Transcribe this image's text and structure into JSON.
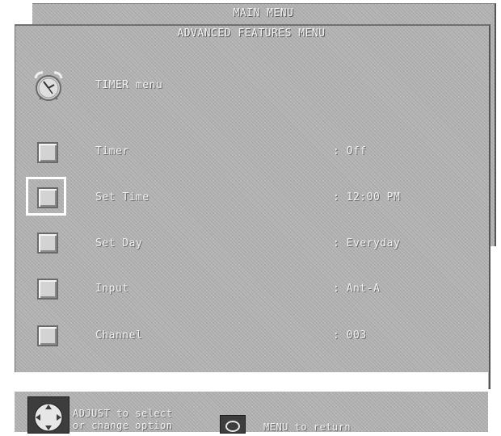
{
  "main_menu_title": "MAIN MENU",
  "advanced_title": "ADVANCED FEATURES MENU",
  "timer_header": "TIMER menu",
  "rows": [
    {
      "label": "Timer",
      "value": ":  Off"
    },
    {
      "label": "Set Time",
      "value": ": 12:00 PM"
    },
    {
      "label": "Set Day",
      "value": ": Everyday"
    },
    {
      "label": "Input",
      "value": ": Ant-A"
    },
    {
      "label": "Channel",
      "value": ": 003"
    }
  ],
  "selected_row": "Set Time",
  "footer": {
    "adjust_line1": "ADJUST to select",
    "adjust_line2": "or change option",
    "menu_hint": "MENU to return"
  },
  "icons": {
    "clock": "alarm-clock-icon",
    "pad": "adjust-pad-icon",
    "menu": "menu-button-icon"
  },
  "colors": {
    "panel": "#b4b4b4",
    "text": "#f2f2f2",
    "highlight": "#ffffff",
    "button": "#3d3d3d"
  }
}
